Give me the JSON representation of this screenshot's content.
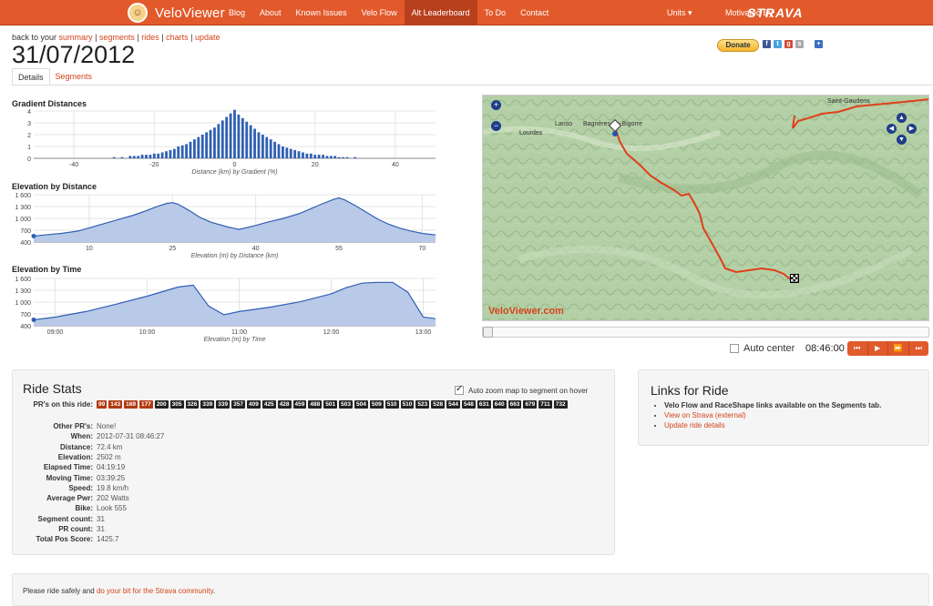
{
  "nav": {
    "brand": "VeloViewer",
    "items": [
      "Blog",
      "About",
      "Known Issues",
      "Velo Flow",
      "Alt Leaderboard",
      "To Do",
      "Contact"
    ],
    "active_item": "Alt Leaderboard",
    "units": "Units ▾",
    "motivated_by": "Motivated By",
    "strava": "STRAVA"
  },
  "breadcrumbs": {
    "prefix": "back to your",
    "summary": "summary",
    "segments": "segments",
    "rides": "rides",
    "charts": "charts",
    "update": "update",
    "sep": " | "
  },
  "page_title": "31/07/2012",
  "donate_label": "Donate",
  "share_icons": [
    "facebook-icon",
    "twitter-icon",
    "google-plus-icon",
    "share-icon",
    "add-icon"
  ],
  "tabs": [
    "Details",
    "Segments"
  ],
  "active_tab": "Details",
  "charts": {
    "gradient": {
      "title": "Gradient Distances",
      "xlabel": "Distance (km) by Gradient (%)"
    },
    "elev_dist": {
      "title": "Elevation by Distance",
      "xlabel": "Elevation (m) by Distance (km)"
    },
    "elev_time": {
      "title": "Elevation by Time",
      "xlabel": "Elevation (m) by Time"
    }
  },
  "chart_data": [
    {
      "type": "bar",
      "title": "Gradient Distances",
      "xlabel": "Distance (km) by Gradient (%)",
      "ylabel": "",
      "xlim": [
        -50,
        50
      ],
      "ylim": [
        0,
        4
      ],
      "x_ticks": [
        -40,
        -20,
        0,
        20,
        40
      ],
      "y_ticks": [
        0,
        1,
        2,
        3,
        4
      ],
      "x": [
        -30,
        -28,
        -26,
        -25,
        -24,
        -23,
        -22,
        -21,
        -20,
        -19,
        -18,
        -17,
        -16,
        -15,
        -14,
        -13,
        -12,
        -11,
        -10,
        -9,
        -8,
        -7,
        -6,
        -5,
        -4,
        -3,
        -2,
        -1,
        0,
        1,
        2,
        3,
        4,
        5,
        6,
        7,
        8,
        9,
        10,
        11,
        12,
        13,
        14,
        15,
        16,
        17,
        18,
        19,
        20,
        21,
        22,
        23,
        24,
        25,
        26,
        27,
        28,
        30
      ],
      "values": [
        0.1,
        0.1,
        0.2,
        0.2,
        0.2,
        0.3,
        0.3,
        0.3,
        0.4,
        0.4,
        0.5,
        0.6,
        0.7,
        0.8,
        1.0,
        1.1,
        1.2,
        1.4,
        1.6,
        1.8,
        2.0,
        2.2,
        2.4,
        2.6,
        2.9,
        3.2,
        3.5,
        3.8,
        4.1,
        3.7,
        3.4,
        3.1,
        2.8,
        2.5,
        2.2,
        2.0,
        1.8,
        1.6,
        1.4,
        1.2,
        1.0,
        0.9,
        0.8,
        0.7,
        0.6,
        0.5,
        0.4,
        0.4,
        0.3,
        0.3,
        0.3,
        0.2,
        0.2,
        0.2,
        0.1,
        0.1,
        0.1,
        0.1
      ]
    },
    {
      "type": "area",
      "title": "Elevation by Distance",
      "xlabel": "Elevation (m) by Distance (km)",
      "ylabel": "",
      "xlim": [
        0,
        72.4
      ],
      "ylim": [
        400,
        1600
      ],
      "x_ticks": [
        10,
        25,
        40,
        55,
        70
      ],
      "y_ticks": [
        "400",
        "700",
        "1 000",
        "1 300",
        "1 600"
      ],
      "x": [
        0,
        2,
        5,
        8,
        10,
        12,
        15,
        18,
        20,
        22,
        24,
        25,
        26,
        28,
        30,
        32,
        35,
        37,
        40,
        42,
        45,
        48,
        50,
        52,
        54,
        55,
        56,
        58,
        60,
        62,
        64,
        66,
        68,
        70,
        72.4
      ],
      "values": [
        550,
        580,
        620,
        680,
        760,
        840,
        960,
        1080,
        1180,
        1290,
        1380,
        1400,
        1360,
        1200,
        1020,
        900,
        780,
        720,
        820,
        900,
        1000,
        1130,
        1250,
        1370,
        1480,
        1520,
        1470,
        1320,
        1150,
        980,
        850,
        750,
        680,
        620,
        580
      ]
    },
    {
      "type": "area",
      "title": "Elevation by Time",
      "xlabel": "Elevation (m) by Time",
      "ylabel": "",
      "xlim": [
        "08:46",
        "13:08"
      ],
      "ylim": [
        400,
        1600
      ],
      "x_ticks": [
        "09:00",
        "10:00",
        "11:00",
        "12:00",
        "13:00"
      ],
      "y_ticks": [
        "400",
        "700",
        "1 000",
        "1 300",
        "1 600"
      ],
      "x": [
        "08:46",
        "09:00",
        "09:20",
        "09:40",
        "10:00",
        "10:20",
        "10:30",
        "10:40",
        "10:50",
        "11:00",
        "11:20",
        "11:40",
        "12:00",
        "12:10",
        "12:20",
        "12:30",
        "12:40",
        "12:50",
        "13:00",
        "13:08"
      ],
      "values": [
        550,
        620,
        760,
        950,
        1150,
        1380,
        1430,
        900,
        680,
        760,
        870,
        1010,
        1210,
        1370,
        1480,
        1500,
        1500,
        1250,
        620,
        580
      ]
    }
  ],
  "map": {
    "labels": [
      "Lourdes",
      "Lanso",
      "Bagnères-de-Bigorre",
      "Saint-Gaudens"
    ],
    "watermark": "VeloViewer.com"
  },
  "playback": {
    "auto_center_label": "Auto center",
    "time": "08:46:00",
    "controls": [
      "⏮",
      "▶",
      "⏩",
      "⏭"
    ]
  },
  "ride_stats": {
    "title": "Ride Stats",
    "auto_zoom_label": "Auto zoom map to segment on hover",
    "prs_label": "PR's on this ride:",
    "prs": [
      "99",
      "143",
      "169",
      "177",
      "200",
      "305",
      "326",
      "339",
      "339",
      "357",
      "409",
      "425",
      "428",
      "459",
      "488",
      "501",
      "503",
      "504",
      "509",
      "510",
      "510",
      "523",
      "528",
      "544",
      "548",
      "631",
      "640",
      "663",
      "679",
      "711",
      "732"
    ],
    "prs_highlighted": [
      "99",
      "143",
      "169",
      "177"
    ],
    "rows": [
      {
        "k": "Other PR's:",
        "v": "None!"
      },
      {
        "k": "When:",
        "v": "2012-07-31 08:46:27"
      },
      {
        "k": "Distance:",
        "v": "72.4 km"
      },
      {
        "k": "Elevation:",
        "v": "2502 m"
      },
      {
        "k": "Elapsed Time:",
        "v": "04:19:19"
      },
      {
        "k": "Moving Time:",
        "v": "03:39:25"
      },
      {
        "k": "Speed:",
        "v": "19.8 km/h"
      },
      {
        "k": "Average Pwr:",
        "v": "202 Watts"
      },
      {
        "k": "Bike:",
        "v": "Look 555"
      },
      {
        "k": "Segment count:",
        "v": "31"
      },
      {
        "k": "PR count:",
        "v": "31"
      },
      {
        "k": "Total Pos Score:",
        "v": "1425.7"
      }
    ]
  },
  "links_for_ride": {
    "title": "Links for Ride",
    "note": "Velo Flow and RaceShape links available on the Segments tab.",
    "view_strava": "View on Strava (external)",
    "update": "Update ride details"
  },
  "footer": {
    "text": "Please ride safely and",
    "link": "do your bit for the Strava community",
    "end": "."
  }
}
